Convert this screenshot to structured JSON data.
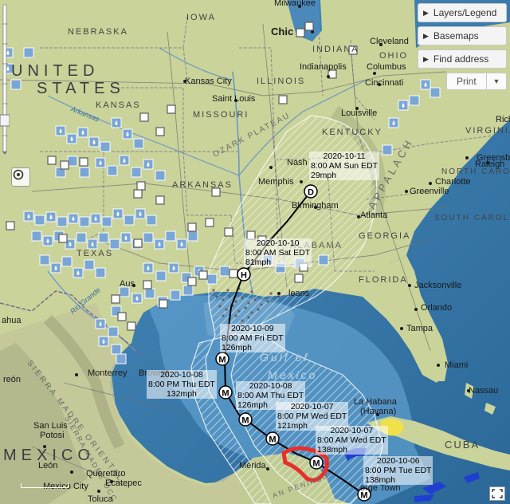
{
  "panel": {
    "layers_label": "Layers/Legend",
    "basemaps_label": "Basemaps",
    "find_address_label": "Find address",
    "print_label": "Print"
  },
  "labels": {
    "states": {
      "nebraska": "NEBRASKA",
      "iowa": "IOWA",
      "kansas": "KANSAS",
      "missouri": "MISSOURI",
      "illinois": "ILLINOIS",
      "indiana": "INDIANA",
      "ohio": "OHIO",
      "kentucky": "KENTUCKY",
      "virginia": "VIRGINIA",
      "north_carolina": "NORTH CAROLINA",
      "south_carolina": "SOUTH CAROLINA",
      "georgia": "GEORGIA",
      "florida": "FLORIDA",
      "texas": "TEXAS",
      "arkansas": "ARKANSAS",
      "alabama": "ALABAMA"
    },
    "country": {
      "united": "UNITED",
      "states": "STATES",
      "mexico": "MEXICO",
      "cuba": "CUBA"
    },
    "cities": {
      "milwaukee": "Milwaukee",
      "chicago": "Chic",
      "cleveland": "Cleveland",
      "indianapolis": "Indianapolis",
      "columbus": "Columbus",
      "cincinnati": "Cincinnati",
      "kansas_city": "Kansas City",
      "st_louis": "Saint Louis",
      "louisville": "Louisville",
      "greensboro": "Greensboro",
      "raleigh": "Raleigh",
      "charlotte": "Charlotte",
      "greenville": "Greenville",
      "memphis": "Memphis",
      "birmingham": "Birmingham",
      "atlanta": "Atlanta",
      "nashville": "Nash",
      "jacksonville": "Jacksonville",
      "orlando": "Orlando",
      "tampa": "Tampa",
      "miami": "Miami",
      "nassau": "Nassau",
      "la_habana": "La Habana",
      "havana": "(Havana)",
      "new_orleans": "leans",
      "austin": "Aus",
      "monterrey": "Monterrey",
      "brownsville": "Browns",
      "san_luis_potosi_1": "San Luis",
      "san_luis_potosi_2": "Potosi",
      "leon": "León",
      "queretaro": "Queretaro",
      "ecatepec": "Ecatepec",
      "mexico_city": "Mexico City",
      "toluca": "Toluca",
      "merida": "Mérida",
      "george_town": "orge Town",
      "richmond": "Rich",
      "torreon": "reón",
      "huahua": "ahua"
    },
    "water": {
      "gulf_of": "Gulf of",
      "mexico": "Mexico"
    },
    "terrain": {
      "ozark": "OZARK PLATEAU",
      "appalachian": "APPALACH",
      "sierra": "SIERRA MADRE ORIENTAL",
      "sierra_occ": "SIERRA MADRE OCC",
      "yucatan": "AN PENINSU",
      "rio_grande": "Rio Grande",
      "arkansas_river": "Arkansas"
    }
  },
  "track": {
    "points": [
      {
        "date": "2020-10-11",
        "time": "8:00 AM Sun EDT",
        "wind": "29mph",
        "marker": "D"
      },
      {
        "date": "2020-10-10",
        "time": "8:00 AM Sat EDT",
        "wind": "81mph",
        "marker": "H"
      },
      {
        "date": "2020-10-09",
        "time": "8:00 AM Fri EDT",
        "wind": "126mph",
        "marker": "M"
      },
      {
        "date": "2020-10-08",
        "time": "8:00 PM Thu EDT",
        "wind": "132mph",
        "marker": "M"
      },
      {
        "date": "2020-10-08",
        "time": "8:00 AM Thu EDT",
        "wind": "126mph",
        "marker": "M"
      },
      {
        "date": "2020-10-07",
        "time": "8:00 PM Wed EDT",
        "wind": "121mph",
        "marker": "M"
      },
      {
        "date": "2020-10-07",
        "time": "8:00 AM Wed EDT",
        "wind": "138mph",
        "marker": "M"
      },
      {
        "date": "2020-10-06",
        "time": "8:00 PM Tue EDT",
        "wind": "138mph",
        "marker": "M"
      }
    ]
  },
  "colors": {
    "land": "#c9d39a",
    "ocean": "#3f7fb0",
    "track": "#000000",
    "cone": "#ffffff",
    "warning": "#e8302a",
    "watch": "#f0e04a",
    "surge": "#1f3fd0",
    "flood_icon": "#7aa6d6"
  },
  "icons": {
    "flood": "raindrop-icon",
    "gauge": "square-gauge-icon",
    "locate": "locate-icon",
    "fullscreen": "fullscreen-icon"
  }
}
